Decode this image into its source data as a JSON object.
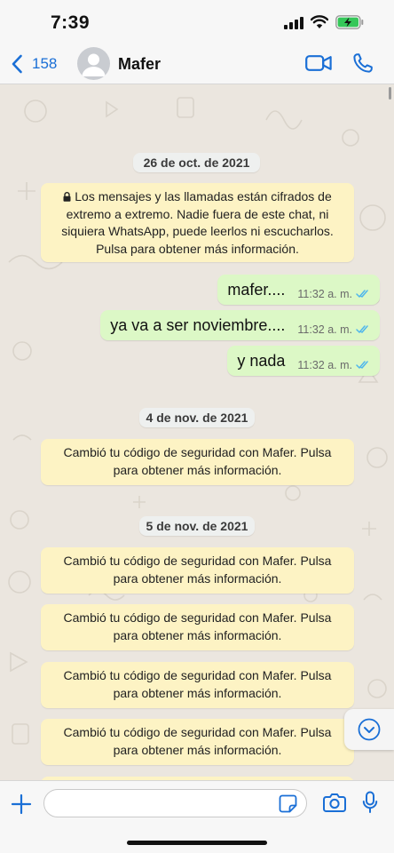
{
  "status_bar": {
    "time": "7:39",
    "signal_icon": "cellular-signal-icon",
    "wifi_icon": "wifi-icon",
    "battery_icon": "battery-charging-icon"
  },
  "header": {
    "back_count": "158",
    "contact_name": "Mafer",
    "icons": [
      "back-chevron-icon",
      "avatar-placeholder-icon",
      "video-call-icon",
      "phone-call-icon"
    ],
    "accent_color": "#1a6fd6"
  },
  "chat": {
    "date_1": "26 de oct. de 2021",
    "encryption_notice": "Los mensajes y las llamadas están cifrados de extremo a extremo. Nadie fuera de este chat, ni siquiera WhatsApp, puede leerlos ni escucharlos. Pulsa para obtener más información.",
    "messages": [
      {
        "text": "mafer....",
        "time": "11:32 a. m.",
        "status": "read"
      },
      {
        "text": "ya va a ser noviembre....",
        "time": "11:32 a. m.",
        "status": "read"
      },
      {
        "text": "y nada",
        "time": "11:32 a. m.",
        "status": "read"
      }
    ],
    "date_2": "4 de nov. de 2021",
    "security_notice_1": "Cambió tu código de seguridad con Mafer. Pulsa para obtener más información.",
    "date_3": "5 de nov. de 2021",
    "security_notices": [
      "Cambió tu código de seguridad con Mafer. Pulsa para obtener más información.",
      "Cambió tu código de seguridad con Mafer. Pulsa para obtener más información.",
      "Cambió tu código de seguridad con Mafer. Pulsa para obtener más información.",
      "Cambió tu código de seguridad con Mafer. Pulsa para obtener más información."
    ],
    "colors": {
      "background": "#ebe6df",
      "outgoing_bubble": "#dcf8c6",
      "notice": "#fdf3c4",
      "read_ticks": "#4fb6ec"
    }
  },
  "input_bar": {
    "message_value": "",
    "icons": [
      "plus-icon",
      "sticker-icon",
      "camera-icon",
      "microphone-icon"
    ]
  }
}
